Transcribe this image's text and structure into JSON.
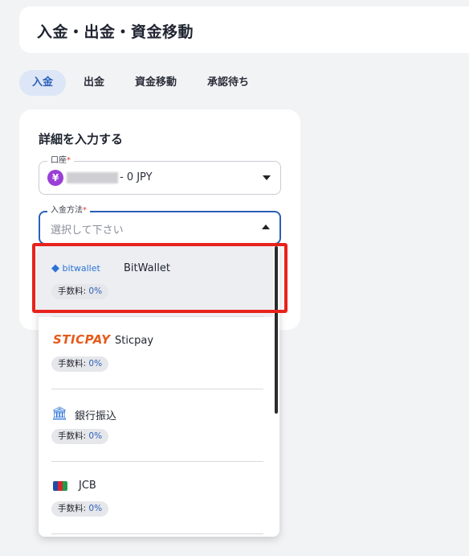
{
  "header": {
    "title": "入金・出金・資金移動"
  },
  "tabs": [
    {
      "label": "入金",
      "active": true
    },
    {
      "label": "出金",
      "active": false
    },
    {
      "label": "資金移動",
      "active": false
    },
    {
      "label": "承認待ち",
      "active": false
    }
  ],
  "form": {
    "section_title": "詳細を入力する",
    "account": {
      "label": "口座",
      "required_mark": "*",
      "currency_icon": "¥",
      "value": "- 0 JPY"
    },
    "method": {
      "label": "入金方法",
      "required_mark": "*",
      "placeholder": "選択して下さい"
    }
  },
  "dropdown": {
    "options": [
      {
        "logo_text": "bitwallet",
        "name": "BitWallet",
        "fee_label": "手数料:",
        "fee_value": "0%"
      },
      {
        "logo_text": "STICPAY",
        "name": "Sticpay",
        "fee_label": "手数料:",
        "fee_value": "0%"
      },
      {
        "logo_text": "🏛",
        "name": "銀行振込",
        "fee_label": "手数料:",
        "fee_value": "0%"
      },
      {
        "logo_text": "",
        "name": "JCB",
        "fee_label": "手数料:",
        "fee_value": "0%"
      }
    ]
  },
  "colors": {
    "accent": "#2c5fb8",
    "highlight": "#e8231c",
    "sticpay": "#e55a1c",
    "bitwallet": "#2b73d6"
  }
}
